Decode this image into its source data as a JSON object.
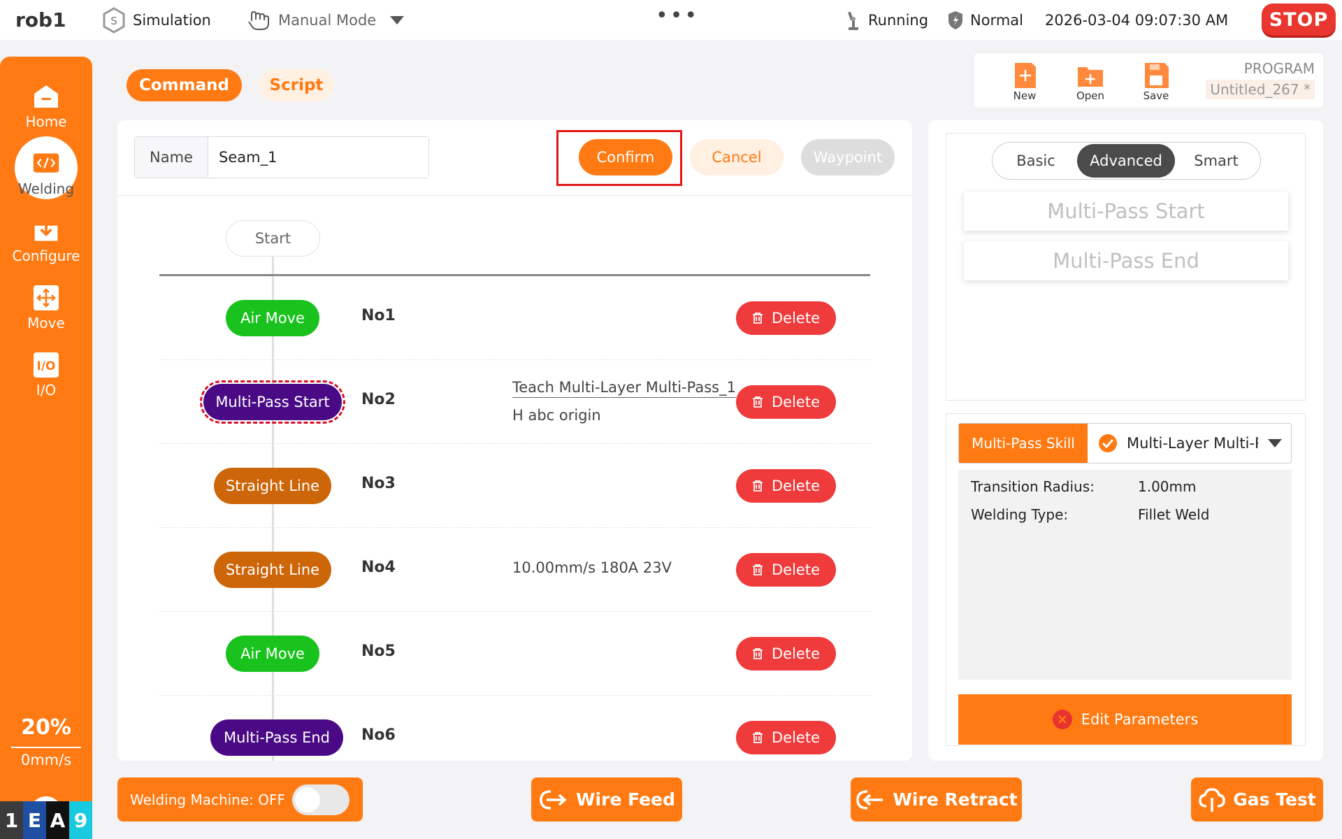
{
  "topbar": {
    "robot_name": "rob1",
    "sim_label": "Simulation",
    "mode_label": "Manual Mode",
    "more_glyph": "•••",
    "status_running": "Running",
    "status_safety": "Normal",
    "datetime": "2026-03-04 09:07:30 AM",
    "stop_label": "STOP"
  },
  "sidebar": {
    "items": [
      {
        "label": "Home",
        "icon": "home-icon"
      },
      {
        "label": "Welding",
        "icon": "code-icon",
        "active": true
      },
      {
        "label": "Configure",
        "icon": "download-icon"
      },
      {
        "label": "Move",
        "icon": "move-icon"
      },
      {
        "label": "I/O",
        "icon": "io-icon"
      }
    ],
    "speed_percent": "20%",
    "speed_mm": "0mm/s",
    "badges": [
      "1",
      "E",
      "A",
      "9"
    ]
  },
  "mode_tabs": {
    "command": "Command",
    "script": "Script"
  },
  "toolbar": {
    "new_label": "New",
    "open_label": "Open",
    "save_label": "Save",
    "program_label": "PROGRAM",
    "program_name": "Untitled_267 *"
  },
  "editor": {
    "name_label": "Name",
    "name_value": "Seam_1",
    "confirm_label": "Confirm",
    "cancel_label": "Cancel",
    "waypoint_label": "Waypoint",
    "start_label": "Start",
    "delete_label": "Delete",
    "rows": [
      {
        "node": "Air Move",
        "id": "No1",
        "info1": "",
        "info2": ""
      },
      {
        "node": "Multi-Pass Start",
        "id": "No2",
        "info1": "Teach Multi-Layer Multi-Pass_1",
        "info2": "H abc origin"
      },
      {
        "node": "Straight Line",
        "id": "No3",
        "info1": "",
        "info2": ""
      },
      {
        "node": "Straight Line",
        "id": "No4",
        "info1": "10.00mm/s 180A 23V",
        "info2": ""
      },
      {
        "node": "Air Move",
        "id": "No5",
        "info1": "",
        "info2": ""
      },
      {
        "node": "Multi-Pass End",
        "id": "No6",
        "info1": "",
        "info2": ""
      }
    ]
  },
  "right_panel": {
    "tabs": [
      "Basic",
      "Advanced",
      "Smart"
    ],
    "active_tab": "Advanced",
    "skill_cards": [
      "Multi-Pass Start",
      "Multi-Pass End"
    ],
    "skill_tag": "Multi-Pass Skill",
    "skill_value": "Multi-Layer Multi-P",
    "params": [
      {
        "label": "Transition Radius:",
        "value": "1.00mm"
      },
      {
        "label": "Welding Type:",
        "value": "Fillet Weld"
      }
    ],
    "edit_label": "Edit Parameters"
  },
  "bottom": {
    "machine_label": "Welding Machine: OFF",
    "wire_feed": "Wire Feed",
    "wire_retract": "Wire Retract",
    "gas_test": "Gas Test"
  },
  "colors": {
    "accent": "#ff7a12",
    "air_move": "#19c21c",
    "straight_line": "#cd6609",
    "multi_pass": "#4a0a85",
    "delete": "#ef3b3b",
    "stop": "#e9362f"
  }
}
